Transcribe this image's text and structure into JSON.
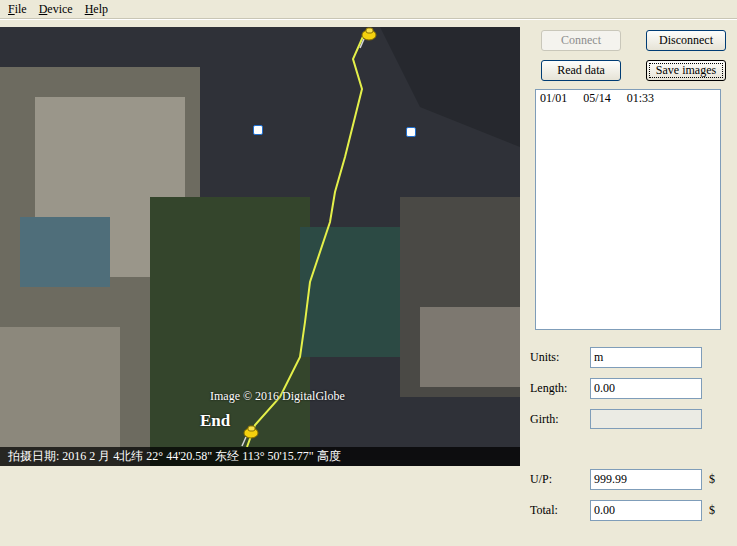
{
  "window": {
    "title": ""
  },
  "menu": [
    {
      "label": "File",
      "mnemonic_index": 0
    },
    {
      "label": "Device",
      "mnemonic_index": 0
    },
    {
      "label": "Help",
      "mnemonic_index": 0
    }
  ],
  "map": {
    "attribution": "Image © 2016 DigitalGlobe",
    "end_label": "End",
    "status": "拍摄日期: 2016 2 月  4北纬 22° 44'20.58\"  东经 113° 50'15.77\"  高度"
  },
  "buttons": [
    {
      "label": "Connect",
      "disabled": true,
      "focused": false
    },
    {
      "label": "Disconnect",
      "disabled": false,
      "focused": false
    },
    {
      "label": "Read data",
      "disabled": false,
      "focused": false
    },
    {
      "label": "Save images",
      "disabled": false,
      "focused": true
    }
  ],
  "records": [
    {
      "cells": [
        "01/01",
        "05/14",
        "01:33"
      ],
      "selected": false
    }
  ],
  "measure_fields": [
    {
      "label": "Units:",
      "value": "m",
      "disabled": false,
      "suffix": ""
    },
    {
      "label": "Length:",
      "value": "0.00",
      "disabled": false,
      "suffix": ""
    },
    {
      "label": "Girth:",
      "value": "",
      "disabled": true,
      "suffix": ""
    }
  ],
  "cost_fields": [
    {
      "label": "U/P:",
      "value": "999.99",
      "disabled": false,
      "suffix": "$"
    },
    {
      "label": "Total:",
      "value": "0.00",
      "disabled": false,
      "suffix": "$"
    }
  ]
}
